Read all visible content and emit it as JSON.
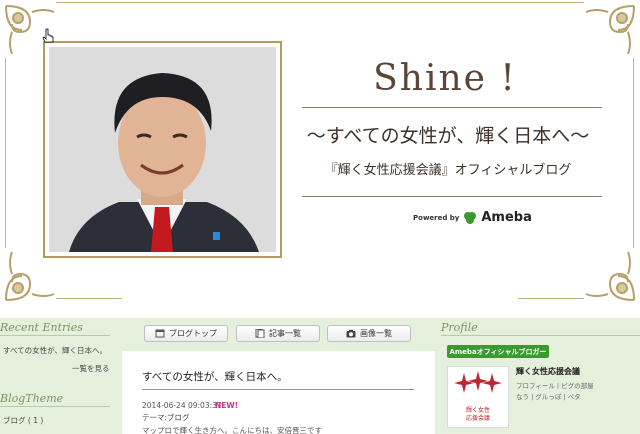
{
  "header": {
    "title": "Shine !",
    "subtitle": "〜すべての女性が、輝く日本へ〜",
    "official": "『輝く女性応援会議』オフィシャルブログ",
    "powered_label": "Powered by",
    "ameba_label": "Ameba"
  },
  "sidebar_left": {
    "recent_title": "Recent Entries",
    "recent_items": [
      "すべての女性が、輝く日本へ。"
    ],
    "more_label": "一覧を見る",
    "theme_title": "BlogTheme",
    "theme_items": [
      "ブログ ( 1 )"
    ]
  },
  "nav": {
    "blog_top": "ブログトップ",
    "entries_list": "記事一覧",
    "images_list": "画像一覧"
  },
  "article": {
    "title": "すべての女性が、輝く日本へ。",
    "date": "2014-06-24 09:03:37",
    "new_badge": "NEW!",
    "theme": "テーマ:ブログ",
    "snippet": "マップロで輝く生き方へ。こんにちは、安倍晋三です"
  },
  "sidebar_right": {
    "profile_title": "Profile",
    "badge_label": "Amebaオフィシャルブロガー",
    "logo_text_1": "輝く女性",
    "logo_text_2": "応援会議",
    "blogger_name": "輝く女性応援会議",
    "links_line1": "プロフィール | ピグの部屋",
    "links_line2": "なう | グルっぽ | ペタ"
  },
  "colors": {
    "accent_gold": "#c8b27a",
    "content_bg": "#e5f0dc",
    "ameba_green": "#3a9a2f",
    "new_pink": "#d0308a",
    "logo_red": "#c02230"
  }
}
